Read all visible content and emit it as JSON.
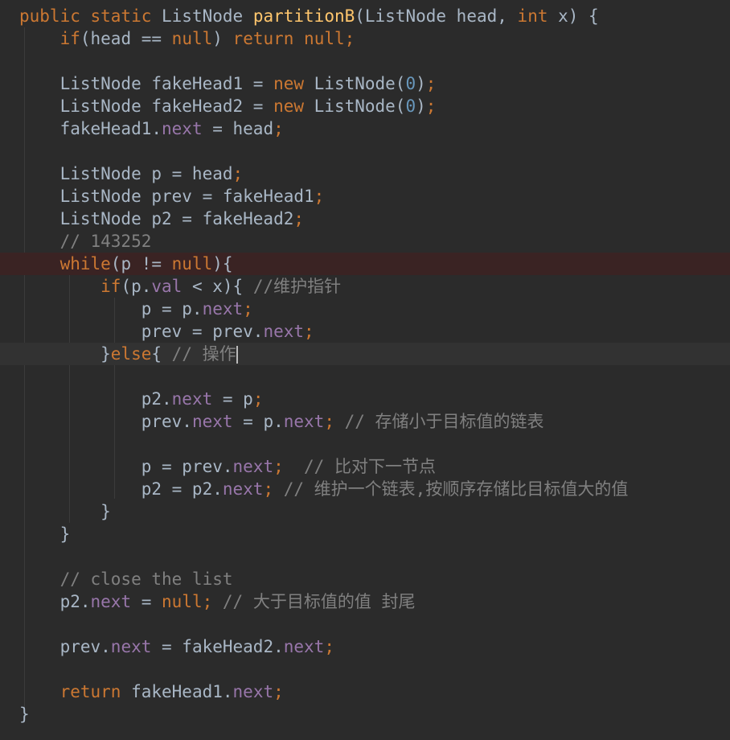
{
  "editor": {
    "theme_colors": {
      "background": "#2b2b2b",
      "keyword": "#cc7832",
      "method_name": "#ffc66d",
      "field": "#9876aa",
      "number": "#6897bb",
      "comment": "#808080",
      "text": "#a9b7c6",
      "breakpoint_line": "#3a2323",
      "caret_line": "#323232"
    },
    "breakpoint_line": 12,
    "caret_line": 16,
    "lines": [
      [
        [
          "k",
          "public static "
        ],
        [
          "t",
          "ListNode "
        ],
        [
          "fn",
          "partitionB"
        ],
        [
          "t",
          "(ListNode head, "
        ],
        [
          "k",
          "int "
        ],
        [
          "t",
          "x) {"
        ]
      ],
      [
        [
          "t",
          "    "
        ],
        [
          "k",
          "if"
        ],
        [
          "t",
          "(head == "
        ],
        [
          "k",
          "null"
        ],
        [
          "t",
          ") "
        ],
        [
          "k",
          "return null"
        ],
        [
          "k",
          ";"
        ]
      ],
      [],
      [
        [
          "t",
          "    ListNode fakeHead1 = "
        ],
        [
          "k",
          "new "
        ],
        [
          "t",
          "ListNode("
        ],
        [
          "n",
          "0"
        ],
        [
          "t",
          ")"
        ],
        [
          "k",
          ";"
        ]
      ],
      [
        [
          "t",
          "    ListNode fakeHead2 = "
        ],
        [
          "k",
          "new "
        ],
        [
          "t",
          "ListNode("
        ],
        [
          "n",
          "0"
        ],
        [
          "t",
          ")"
        ],
        [
          "k",
          ";"
        ]
      ],
      [
        [
          "t",
          "    fakeHead1."
        ],
        [
          "f",
          "next"
        ],
        [
          "t",
          " = head"
        ],
        [
          "k",
          ";"
        ]
      ],
      [],
      [
        [
          "t",
          "    ListNode p = head"
        ],
        [
          "k",
          ";"
        ]
      ],
      [
        [
          "t",
          "    ListNode prev = fakeHead1"
        ],
        [
          "k",
          ";"
        ]
      ],
      [
        [
          "t",
          "    ListNode p2 = fakeHead2"
        ],
        [
          "k",
          ";"
        ]
      ],
      [
        [
          "c",
          "    // 143252"
        ]
      ],
      [
        [
          "t",
          "    "
        ],
        [
          "k",
          "while"
        ],
        [
          "t",
          "(p != "
        ],
        [
          "k",
          "null"
        ],
        [
          "t",
          "){"
        ]
      ],
      [
        [
          "t",
          "        "
        ],
        [
          "k",
          "if"
        ],
        [
          "t",
          "(p."
        ],
        [
          "f",
          "val"
        ],
        [
          "t",
          " < x){ "
        ],
        [
          "c",
          "//维护指针"
        ]
      ],
      [
        [
          "t",
          "            p = p."
        ],
        [
          "f",
          "next"
        ],
        [
          "k",
          ";"
        ]
      ],
      [
        [
          "t",
          "            prev = prev."
        ],
        [
          "f",
          "next"
        ],
        [
          "k",
          ";"
        ]
      ],
      [
        [
          "t",
          "        }"
        ],
        [
          "k",
          "else"
        ],
        [
          "t",
          "{ "
        ],
        [
          "c",
          "// 操作"
        ],
        [
          "caret",
          ""
        ]
      ],
      [],
      [
        [
          "t",
          "            p2."
        ],
        [
          "f",
          "next"
        ],
        [
          "t",
          " = p"
        ],
        [
          "k",
          ";"
        ]
      ],
      [
        [
          "t",
          "            prev."
        ],
        [
          "f",
          "next"
        ],
        [
          "t",
          " = p."
        ],
        [
          "f",
          "next"
        ],
        [
          "k",
          ";"
        ],
        [
          "c",
          " // 存储小于目标值的链表"
        ]
      ],
      [],
      [
        [
          "t",
          "            p = prev."
        ],
        [
          "f",
          "next"
        ],
        [
          "k",
          ";"
        ],
        [
          "c",
          "  // 比对下一节点"
        ]
      ],
      [
        [
          "t",
          "            p2 = p2."
        ],
        [
          "f",
          "next"
        ],
        [
          "k",
          ";"
        ],
        [
          "c",
          " // 维护一个链表,按顺序存储比目标值大的值"
        ]
      ],
      [
        [
          "t",
          "        }"
        ]
      ],
      [
        [
          "t",
          "    }"
        ]
      ],
      [],
      [
        [
          "c",
          "    // close the list"
        ]
      ],
      [
        [
          "t",
          "    p2."
        ],
        [
          "f",
          "next"
        ],
        [
          "t",
          " = "
        ],
        [
          "k",
          "null"
        ],
        [
          "k",
          ";"
        ],
        [
          "c",
          " // 大于目标值的值 封尾"
        ]
      ],
      [],
      [
        [
          "t",
          "    prev."
        ],
        [
          "f",
          "next"
        ],
        [
          "t",
          " = fakeHead2."
        ],
        [
          "f",
          "next"
        ],
        [
          "k",
          ";"
        ]
      ],
      [],
      [
        [
          "t",
          "    "
        ],
        [
          "k",
          "return "
        ],
        [
          "t",
          "fakeHead1."
        ],
        [
          "f",
          "next"
        ],
        [
          "k",
          ";"
        ]
      ],
      [
        [
          "t",
          "}"
        ]
      ]
    ]
  }
}
